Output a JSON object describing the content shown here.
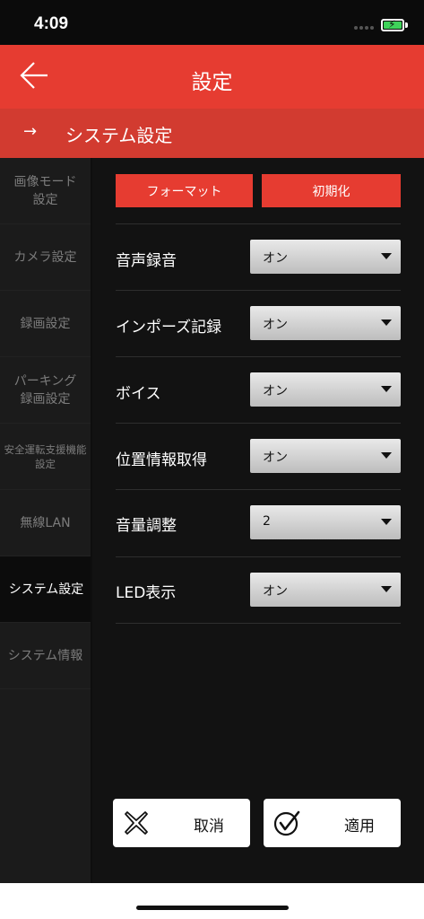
{
  "status_bar": {
    "time": "4:09"
  },
  "header": {
    "title": "設定"
  },
  "subheader": {
    "arrow": "→",
    "title": "システム設定"
  },
  "sidebar": {
    "items": [
      {
        "label": "画像モード\n設定"
      },
      {
        "label": "カメラ設定"
      },
      {
        "label": "録画設定"
      },
      {
        "label": "パーキング\n録画設定"
      },
      {
        "label": "安全運転支援機能\n設定"
      },
      {
        "label": "無線LAN"
      },
      {
        "label": "システム設定",
        "active": true
      },
      {
        "label": "システム情報"
      }
    ]
  },
  "main": {
    "format_button": "フォーマット",
    "reset_button": "初期化",
    "settings": [
      {
        "label": "音声録音",
        "value": "オン"
      },
      {
        "label": "インポーズ記録",
        "value": "オン"
      },
      {
        "label": "ボイス",
        "value": "オン"
      },
      {
        "label": "位置情報取得",
        "value": "オン"
      },
      {
        "label": "音量調整",
        "value": "2"
      },
      {
        "label": "LED表示",
        "value": "オン"
      }
    ],
    "cancel_label": "取消",
    "apply_label": "適用"
  },
  "colors": {
    "header_red": "#e63c31",
    "subheader_red": "#d23b30",
    "background": "#121212",
    "sidebar": "#1b1b1b"
  }
}
